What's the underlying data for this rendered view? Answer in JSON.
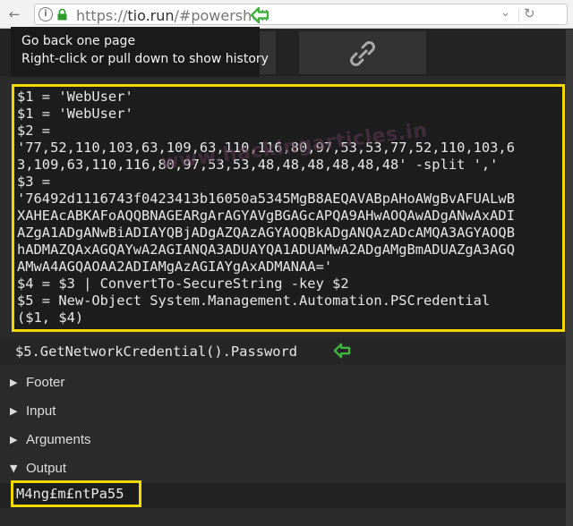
{
  "browser": {
    "url_prefix": "https://",
    "url_host": "tio.run",
    "url_path": "/#powershell"
  },
  "tooltip": {
    "line1": "Go back one page",
    "line2": "Right-click or pull down to show history"
  },
  "code": {
    "lines": [
      "$1 = 'WebUser'",
      "$1 = 'WebUser'",
      "$2 =",
      "'77,52,110,103,63,109,63,110,116,80,97,53,53,77,52,110,103,6",
      "3,109,63,110,116,80,97,53,53,48,48,48,48,48,48' -split ','",
      "$3 =",
      "'76492d1116743f0423413b16050a5345MgB8AEQAVABpAHoAWgBvAFUALwB",
      "XAHEAcABKAFoAQQBNAGEARgArAGYAVgBGAGcAPQA9AHwAOQAwADgANwAxADI",
      "AZgA1ADgANwBiADIAYQBjADgAZQAzAGYAOQBkADgANQAzADcAMQA3AGYAOQB",
      "hADMAZQAxAGQAYwA2AGIANQA3ADUAYQA1ADUAMwA2ADgAMgBmADUAZgA3AGQ",
      "AMwA4AGQAOAA2ADIAMgAzAGIAYgAxADMANAA=' ",
      "$4 = $3 | ConvertTo-SecureString -key $2",
      "$5 = New-Object System.Management.Automation.PSCredential",
      "($1, $4)"
    ]
  },
  "watermark": "www.hackingarticles.in",
  "footer_code": "$5.GetNetworkCredential().Password",
  "sections": {
    "footer": "Footer",
    "input": "Input",
    "arguments": "Arguments",
    "output": "Output"
  },
  "output": {
    "value": "M4ng£m£ntPa55"
  },
  "colors": {
    "highlight": "#f4d800",
    "arrow": "#3cb43c"
  }
}
